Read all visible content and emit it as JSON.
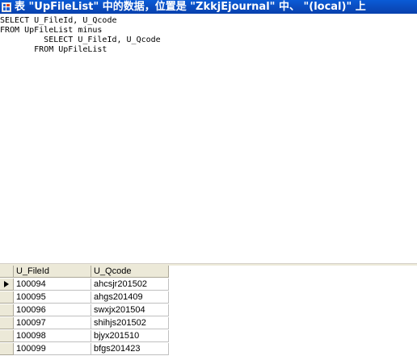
{
  "window": {
    "title": "表 \"UpFileList\" 中的数据，位置是 \"ZkkjEjournal\" 中、 \"(local)\" 上"
  },
  "sql": {
    "lines": [
      "SELECT U_FileId, U_Qcode",
      "FROM UpFileList minus",
      "         SELECT U_FileId, U_Qcode",
      "       FROM UpFileList"
    ]
  },
  "grid": {
    "columns": [
      "U_FileId",
      "U_Qcode"
    ],
    "rows": [
      {
        "U_FileId": "100094",
        "U_Qcode": "ahcsjr201502"
      },
      {
        "U_FileId": "100095",
        "U_Qcode": "ahgs201409"
      },
      {
        "U_FileId": "100096",
        "U_Qcode": "swxjx201504"
      },
      {
        "U_FileId": "100097",
        "U_Qcode": "shihjs201502"
      },
      {
        "U_FileId": "100098",
        "U_Qcode": "bjyx201510"
      },
      {
        "U_FileId": "100099",
        "U_Qcode": "bfgs201423"
      }
    ],
    "current_row_index": 0
  },
  "colors": {
    "titlebar": "#0a4fc3",
    "grid_header": "#ece9d8",
    "grid_line": "#c0c0c0"
  },
  "icons": {
    "window_icon": "table-grid-icon",
    "current_row_marker": "row-pointer-icon"
  }
}
